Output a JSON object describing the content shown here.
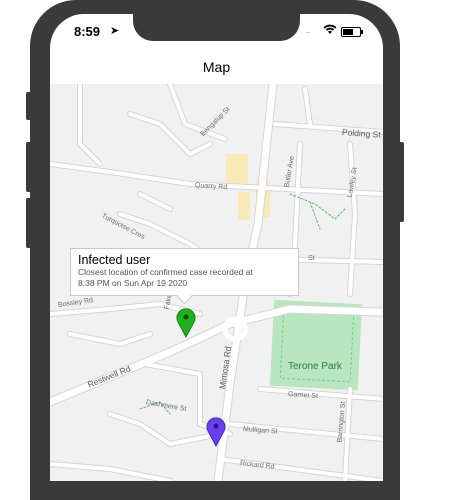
{
  "status_bar": {
    "time": "8:59",
    "location_icon": "location-arrow-icon",
    "signal": "....",
    "wifi_icon": "wifi-icon",
    "battery_icon": "battery-icon"
  },
  "nav": {
    "title": "Map"
  },
  "map": {
    "streets": {
      "polding": "Polding St",
      "bengalup": "Bengalup St",
      "butler": "Butler Ave",
      "lawley": "Lawley St",
      "quarry": "Quarry Rd",
      "turquoise": "Turquoise Cres",
      "fake": "Fake St",
      "st_short": "St",
      "bossley": "Bossley Rd",
      "restwell": "Restwell Rd",
      "mimosa": "Mimosa Rd",
      "garnet": "Garnet St",
      "barrington": "Barrington St",
      "dashmere": "Dashmere St",
      "mulligan": "Mulligan St",
      "rickard": "Rickard Rd"
    },
    "park": "Terone Park",
    "colors": {
      "land": "#f1f1f2",
      "road": "#ffffff",
      "road_outline": "#d6d6d8",
      "park": "#b8e6bf",
      "building": "#f7e9b8",
      "pin_infected": "#1fb01f",
      "pin_user": "#6a3ff0"
    }
  },
  "callout": {
    "title": "Infected user",
    "line1": "Closest location of confirmed case recorded at",
    "line2": "8:38 PM on Sun Apr 19 2020"
  }
}
